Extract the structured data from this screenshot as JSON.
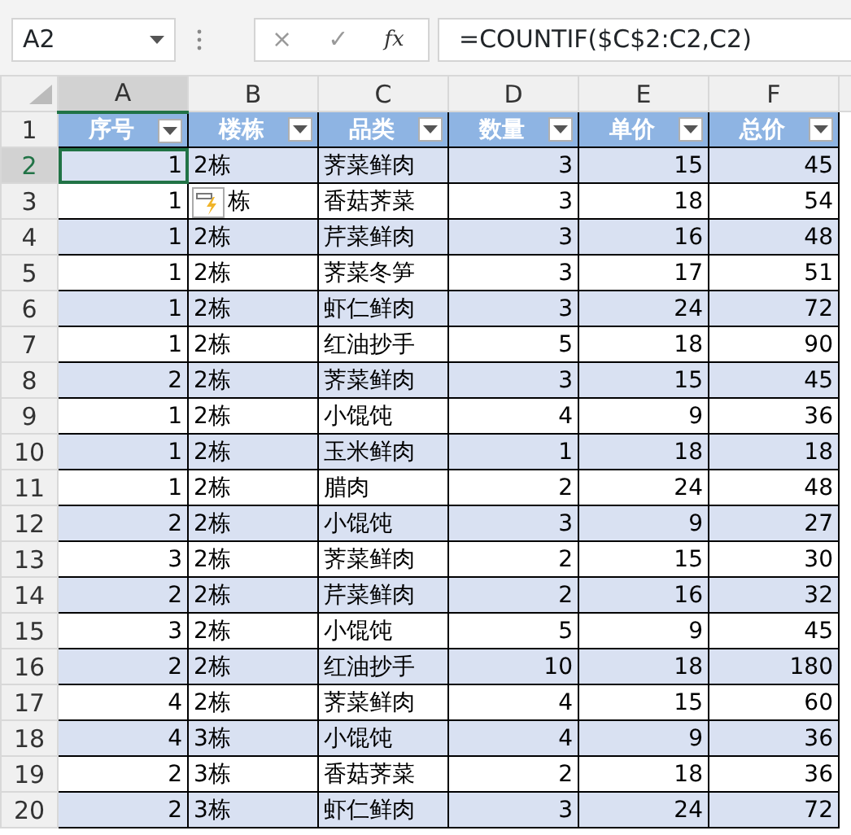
{
  "name_box": {
    "value": "A2"
  },
  "formula_buttons": [
    "×",
    "✓",
    "fx"
  ],
  "formula": {
    "value": "=COUNTIF($C$2:C2,C2)"
  },
  "columns": [
    {
      "label": "A",
      "selected": true
    },
    {
      "label": "B",
      "selected": false
    },
    {
      "label": "C",
      "selected": false
    },
    {
      "label": "D",
      "selected": false
    },
    {
      "label": "E",
      "selected": false
    },
    {
      "label": "F",
      "selected": false
    }
  ],
  "header_row": {
    "number": "1",
    "cells": [
      "序号",
      "楼栋",
      "品类",
      "数量",
      "单价",
      "总价"
    ]
  },
  "rows": [
    {
      "number": "2",
      "selected": true,
      "cells": [
        "1",
        "2栋",
        "荠菜鲜肉",
        "3",
        "15",
        "45"
      ]
    },
    {
      "number": "3",
      "selected": false,
      "smart_tag": true,
      "cells": [
        "1",
        "栋",
        "香菇荠菜",
        "3",
        "18",
        "54"
      ]
    },
    {
      "number": "4",
      "selected": false,
      "cells": [
        "1",
        "2栋",
        "芹菜鲜肉",
        "3",
        "16",
        "48"
      ]
    },
    {
      "number": "5",
      "selected": false,
      "cells": [
        "1",
        "2栋",
        "荠菜冬笋",
        "3",
        "17",
        "51"
      ]
    },
    {
      "number": "6",
      "selected": false,
      "cells": [
        "1",
        "2栋",
        "虾仁鲜肉",
        "3",
        "24",
        "72"
      ]
    },
    {
      "number": "7",
      "selected": false,
      "cells": [
        "1",
        "2栋",
        "红油抄手",
        "5",
        "18",
        "90"
      ]
    },
    {
      "number": "8",
      "selected": false,
      "cells": [
        "2",
        "2栋",
        "荠菜鲜肉",
        "3",
        "15",
        "45"
      ]
    },
    {
      "number": "9",
      "selected": false,
      "cells": [
        "1",
        "2栋",
        "小馄饨",
        "4",
        "9",
        "36"
      ]
    },
    {
      "number": "10",
      "selected": false,
      "cells": [
        "1",
        "2栋",
        "玉米鲜肉",
        "1",
        "18",
        "18"
      ]
    },
    {
      "number": "11",
      "selected": false,
      "cells": [
        "1",
        "2栋",
        "腊肉",
        "2",
        "24",
        "48"
      ]
    },
    {
      "number": "12",
      "selected": false,
      "cells": [
        "2",
        "2栋",
        "小馄饨",
        "3",
        "9",
        "27"
      ]
    },
    {
      "number": "13",
      "selected": false,
      "cells": [
        "3",
        "2栋",
        "荠菜鲜肉",
        "2",
        "15",
        "30"
      ]
    },
    {
      "number": "14",
      "selected": false,
      "cells": [
        "2",
        "2栋",
        "芹菜鲜肉",
        "2",
        "16",
        "32"
      ]
    },
    {
      "number": "15",
      "selected": false,
      "cells": [
        "3",
        "2栋",
        "小馄饨",
        "5",
        "9",
        "45"
      ]
    },
    {
      "number": "16",
      "selected": false,
      "cells": [
        "2",
        "2栋",
        "红油抄手",
        "10",
        "18",
        "180"
      ]
    },
    {
      "number": "17",
      "selected": false,
      "cells": [
        "4",
        "2栋",
        "荠菜鲜肉",
        "4",
        "15",
        "60"
      ]
    },
    {
      "number": "18",
      "selected": false,
      "cells": [
        "4",
        "3栋",
        "小馄饨",
        "4",
        "9",
        "36"
      ]
    },
    {
      "number": "19",
      "selected": false,
      "cells": [
        "2",
        "3栋",
        "香菇荠菜",
        "2",
        "18",
        "36"
      ]
    },
    {
      "number": "20",
      "selected": false,
      "cells": [
        "2",
        "3栋",
        "虾仁鲜肉",
        "3",
        "24",
        "72"
      ]
    }
  ]
}
